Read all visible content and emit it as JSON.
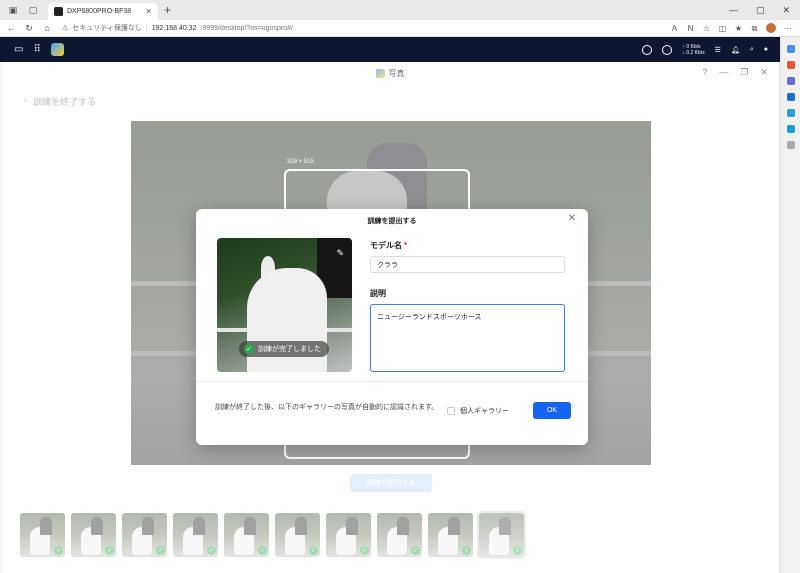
{
  "browser": {
    "tab_title": "DXP6800PRO-BF38",
    "url_warning": "セキュリティ保護なし",
    "url_host": "192.168.40.32",
    "url_path": ":9999/desktop/?os=ugospro#/"
  },
  "nas": {
    "speed_up": "↑ 0 Kb/s",
    "speed_down": "↓ 0.2 Kb/s"
  },
  "app": {
    "title": "写真",
    "back_label": "訓練を終了する",
    "crop_size": "329 × 515",
    "submit_ghost": "訓練を提出する"
  },
  "modal": {
    "title": "訓練を提出する",
    "done_label": "訓練が完了しました",
    "model_label": "モデル名",
    "required_mark": "*",
    "model_value": "クララ",
    "desc_label": "説明",
    "desc_value": "ニュージーランドスポーツホース",
    "footer_text": "訓練が終了した後、以下のギャラリーの写真が自動的に認識されます。",
    "gallery_option": "個人ギャラリー",
    "ok_label": "OK"
  },
  "thumbnails": {
    "count": 10,
    "checked": [
      true,
      true,
      true,
      true,
      true,
      true,
      true,
      true,
      true,
      true
    ]
  },
  "colors": {
    "primary": "#1665f0",
    "success": "#2aa84a",
    "nas_bar": "#0f1730"
  }
}
